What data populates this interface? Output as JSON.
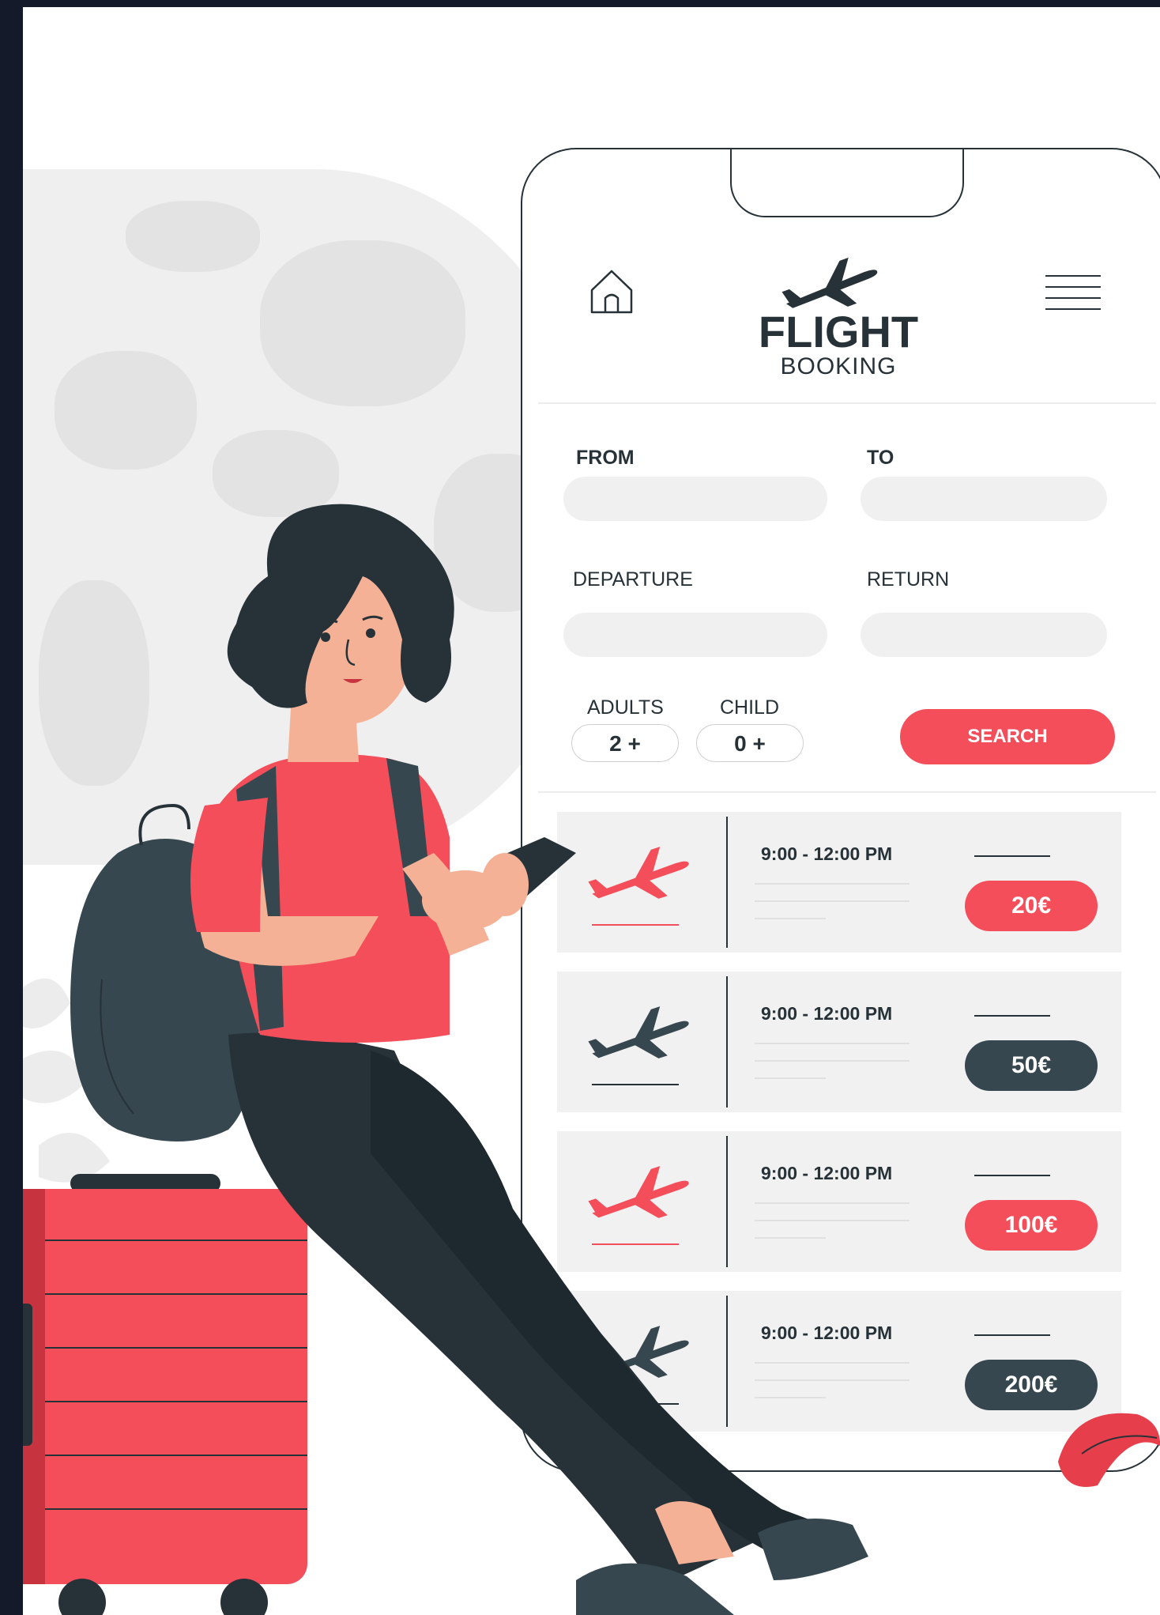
{
  "brand": {
    "title": "FLIGHT",
    "subtitle": "BOOKING"
  },
  "form": {
    "from_label": "FROM",
    "to_label": "TO",
    "departure_label": "DEPARTURE",
    "return_label": "RETURN",
    "adults_label": "ADULTS",
    "child_label": "CHILD",
    "adults_value": "2 +",
    "child_value": "0 +",
    "search_label": "SEARCH"
  },
  "flights": [
    {
      "time": "9:00 - 12:00 PM",
      "price": "20€",
      "style": "red"
    },
    {
      "time": "9:00 - 12:00 PM",
      "price": "50€",
      "style": "dark"
    },
    {
      "time": "9:00 - 12:00 PM",
      "price": "100€",
      "style": "red"
    },
    {
      "time": "9:00 - 12:00 PM",
      "price": "200€",
      "style": "dark"
    }
  ],
  "colors": {
    "accent": "#f44e5a",
    "dark": "#37474f",
    "outline": "#263238",
    "background": "#ffffff",
    "frame": "#141a2a"
  },
  "icons": [
    "home-icon",
    "menu-icon",
    "airplane-icon"
  ]
}
